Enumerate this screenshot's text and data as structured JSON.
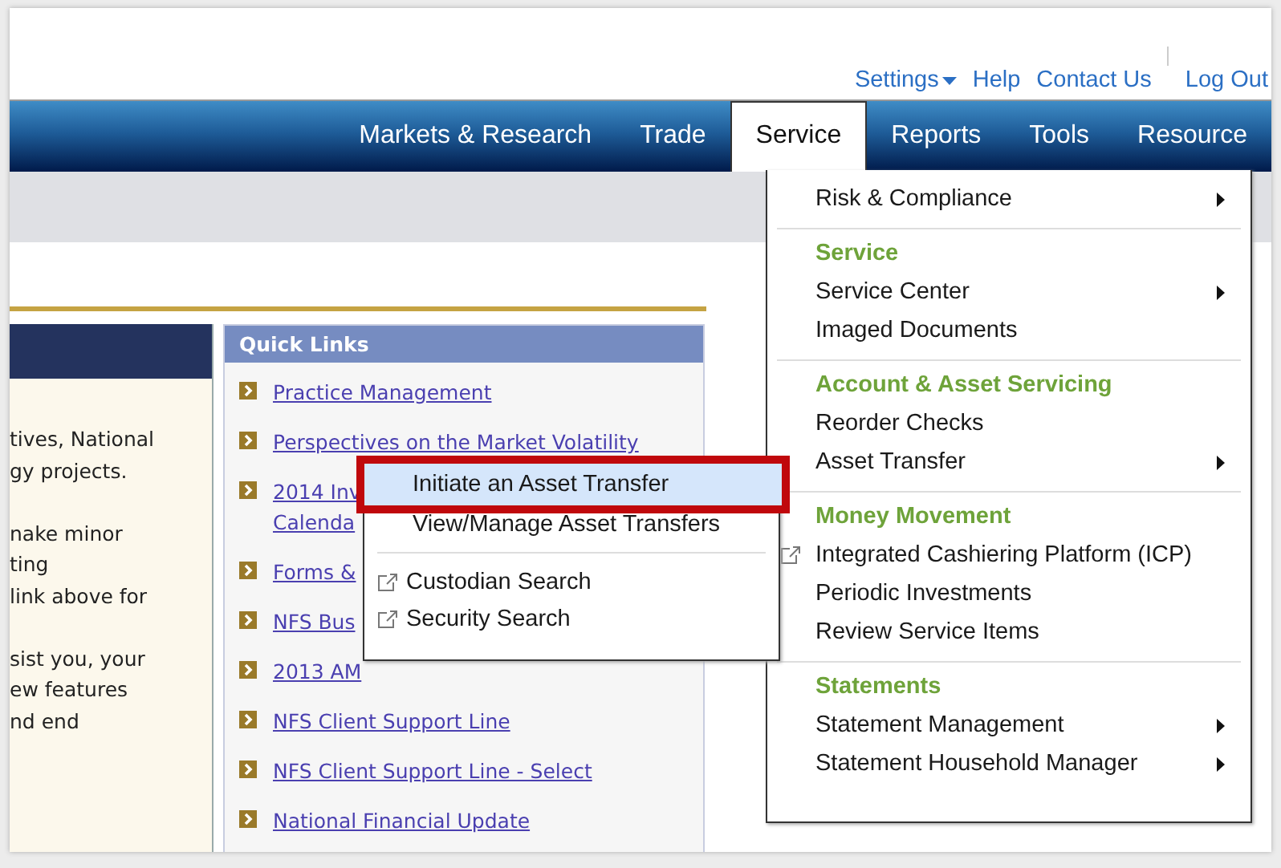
{
  "top_links": [
    {
      "label": "Settings",
      "dropdown": true
    },
    {
      "label": "Help",
      "dropdown": false
    },
    {
      "label": "Contact Us",
      "dropdown": false
    },
    {
      "label": "Log Out",
      "dropdown": false
    }
  ],
  "nav": [
    {
      "label": "Markets & Research",
      "selected": false
    },
    {
      "label": "Trade",
      "selected": false
    },
    {
      "label": "Service",
      "selected": true
    },
    {
      "label": "Reports",
      "selected": false
    },
    {
      "label": "Tools",
      "selected": false
    },
    {
      "label": "Resource",
      "selected": false
    }
  ],
  "left_panel": {
    "paragraphs": [
      [
        "tives, National",
        "gy projects."
      ],
      [
        "nake minor",
        "ting",
        "link above for"
      ],
      [
        "sist you, your",
        "ew features",
        "nd end"
      ]
    ]
  },
  "quick_links": {
    "title": "Quick Links",
    "items": [
      {
        "lines": [
          "Practice Management"
        ]
      },
      {
        "lines": [
          "Perspectives on the Market Volatility"
        ]
      },
      {
        "lines": [
          "2014 Inv",
          "Calenda"
        ]
      },
      {
        "lines": [
          "Forms &"
        ]
      },
      {
        "lines": [
          "NFS Bus"
        ]
      },
      {
        "lines": [
          "2013 AM"
        ]
      },
      {
        "lines": [
          "NFS Client Support Line"
        ]
      },
      {
        "lines": [
          "NFS Client Support Line - Select"
        ]
      },
      {
        "lines": [
          "National Financial Update"
        ]
      }
    ]
  },
  "service_menu": {
    "groups": [
      {
        "items": [
          {
            "kind": "item",
            "label": "Risk & Compliance",
            "submenu": true
          }
        ]
      },
      {
        "heading": "Service",
        "items": [
          {
            "kind": "item",
            "label": "Service Center",
            "submenu": true
          },
          {
            "kind": "item",
            "label": "Imaged Documents",
            "submenu": false
          }
        ]
      },
      {
        "heading": "Account & Asset Servicing",
        "items": [
          {
            "kind": "item",
            "label": "Reorder Checks",
            "submenu": false
          },
          {
            "kind": "item",
            "label": "Asset Transfer",
            "submenu": true
          }
        ]
      },
      {
        "heading": "Money Movement",
        "items": [
          {
            "kind": "external",
            "label": "Integrated Cashiering Platform (ICP)",
            "submenu": false
          },
          {
            "kind": "item",
            "label": "Periodic Investments",
            "submenu": false
          },
          {
            "kind": "item",
            "label": "Review Service Items",
            "submenu": false
          }
        ]
      },
      {
        "heading": "Statements",
        "items": [
          {
            "kind": "item",
            "label": "Statement Management",
            "submenu": true
          },
          {
            "kind": "item",
            "label": "Statement Household Manager",
            "submenu": true
          }
        ]
      }
    ]
  },
  "submenu": {
    "groups": [
      {
        "items": [
          {
            "kind": "item",
            "label": "Initiate an Asset Transfer",
            "selected": true
          },
          {
            "kind": "item",
            "label": "View/Manage Asset Transfers",
            "selected": false
          }
        ]
      },
      {
        "items": [
          {
            "kind": "external",
            "label": "Custodian Search",
            "selected": false
          },
          {
            "kind": "external",
            "label": "Security Search",
            "selected": false
          }
        ]
      }
    ]
  }
}
